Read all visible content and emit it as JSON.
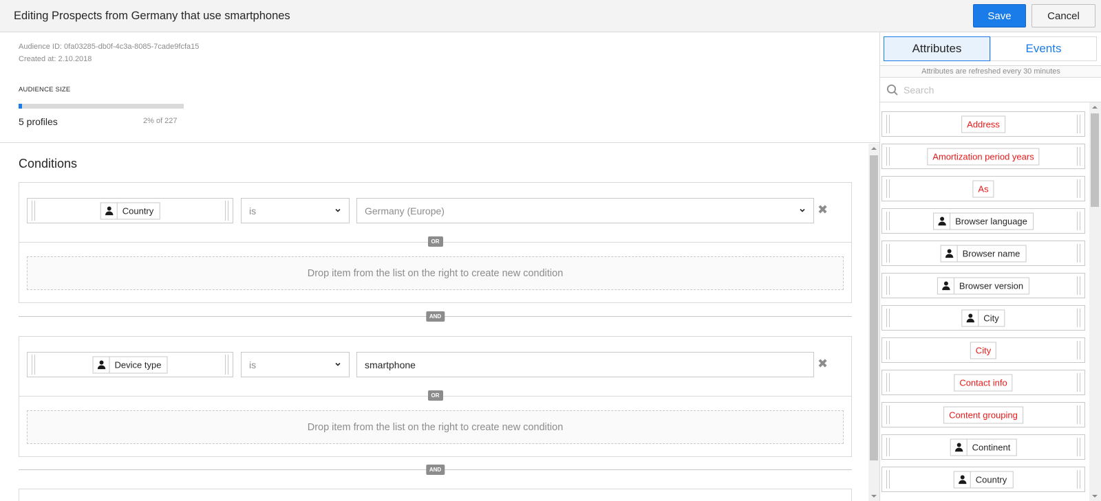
{
  "header": {
    "title": "Editing Prospects from Germany that use smartphones",
    "save_label": "Save",
    "cancel_label": "Cancel"
  },
  "audience": {
    "id_label": "Audience ID: 0fa03285-db0f-4c3a-8085-7cade9fcfa15",
    "created_label": "Created at: 2.10.2018",
    "size_heading": "AUDIENCE SIZE",
    "size_fraction": 0.022,
    "profiles": "5 profiles",
    "percent": "2% of 227"
  },
  "conditions": {
    "title": "Conditions",
    "or_label": "OR",
    "and_label": "AND",
    "drop_hint": "Drop item from the list on the right to create new condition",
    "groups": [
      {
        "attribute": "Country",
        "operator": "is",
        "value": "Germany (Europe)",
        "value_kind": "select"
      },
      {
        "attribute": "Device type",
        "operator": "is",
        "value": "smartphone",
        "value_kind": "input"
      }
    ]
  },
  "sidebar": {
    "tabs": [
      "Attributes",
      "Events"
    ],
    "active_tab": "Attributes",
    "refresh_note": "Attributes are refreshed every 30 minutes",
    "search_placeholder": "Search",
    "items": [
      {
        "label": "Address",
        "profile": false
      },
      {
        "label": "Amortization period years",
        "profile": false
      },
      {
        "label": "As",
        "profile": false
      },
      {
        "label": "Browser language",
        "profile": true
      },
      {
        "label": "Browser name",
        "profile": true
      },
      {
        "label": "Browser version",
        "profile": true
      },
      {
        "label": "City",
        "profile": true
      },
      {
        "label": "City",
        "profile": false
      },
      {
        "label": "Contact info",
        "profile": false
      },
      {
        "label": "Content grouping",
        "profile": false
      },
      {
        "label": "Continent",
        "profile": true
      },
      {
        "label": "Country",
        "profile": true
      }
    ]
  },
  "colors": {
    "accent": "#1a7ce8",
    "custom_attribute": "#e81a1a",
    "badge": "#8c8c8c"
  }
}
